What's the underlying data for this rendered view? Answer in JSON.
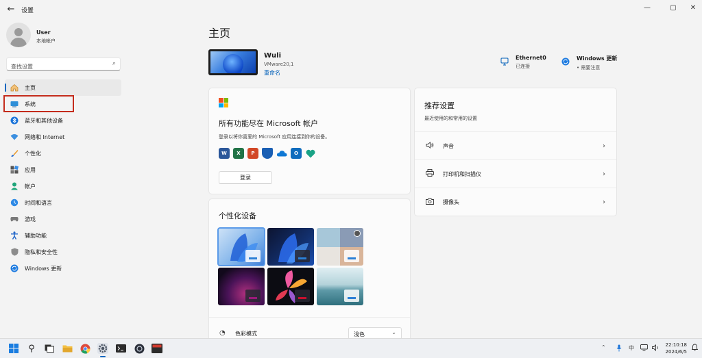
{
  "window": {
    "title": "设置",
    "back_icon": "back-arrow-icon"
  },
  "user": {
    "name": "User",
    "account_type": "本地帐户"
  },
  "search": {
    "placeholder": "查找设置"
  },
  "nav": [
    {
      "label": "主页",
      "icon": "home-icon",
      "active": true
    },
    {
      "label": "系统",
      "icon": "system-display-icon"
    },
    {
      "label": "蓝牙和其他设备",
      "icon": "bluetooth-icon"
    },
    {
      "label": "网络和 Internet",
      "icon": "wifi-icon"
    },
    {
      "label": "个性化",
      "icon": "paintbrush-icon"
    },
    {
      "label": "应用",
      "icon": "apps-icon"
    },
    {
      "label": "帐户",
      "icon": "account-icon"
    },
    {
      "label": "时间和语言",
      "icon": "globe-clock-icon"
    },
    {
      "label": "游戏",
      "icon": "gamepad-icon"
    },
    {
      "label": "辅助功能",
      "icon": "accessibility-icon"
    },
    {
      "label": "隐私和安全性",
      "icon": "shield-icon"
    },
    {
      "label": "Windows 更新",
      "icon": "update-icon"
    }
  ],
  "main": {
    "title": "主页",
    "pc": {
      "name": "Wuli",
      "model": "VMware20,1",
      "rename": "重命名"
    },
    "status": [
      {
        "title": "Ethernet0",
        "sub": "已连接",
        "icon": "ethernet-icon"
      },
      {
        "title": "Windows 更新",
        "sub": "• 需要注意",
        "icon": "update-icon"
      }
    ],
    "account_card": {
      "title": "所有功能尽在 Microsoft 帐户",
      "desc": "登录以将你喜爱的 Microsoft 应用连接到你的设备。",
      "apps": [
        "word-icon",
        "excel-icon",
        "powerpoint-icon",
        "defender-icon",
        "onedrive-icon",
        "outlook-icon",
        "family-icon"
      ],
      "signin": "登录"
    },
    "personalize_card": {
      "title": "个性化设备",
      "themes": [
        "bloom-light-theme",
        "bloom-dark-theme",
        "photo-theme",
        "glow-theme",
        "flower-theme",
        "lake-theme"
      ],
      "color_mode_label": "色彩模式",
      "color_mode_value": "浅色"
    },
    "recommended": {
      "title": "推荐设置",
      "desc": "最近使用的和常用的设置",
      "items": [
        {
          "label": "声音",
          "icon": "speaker-icon"
        },
        {
          "label": "打印机和扫描仪",
          "icon": "printer-icon"
        },
        {
          "label": "摄像头",
          "icon": "camera-icon"
        }
      ]
    }
  },
  "taskbar": {
    "input_lang": "中",
    "time": "22:10:18",
    "date": "2024/6/5"
  },
  "colors": {
    "accent": "#0067c0",
    "highlight_border": "#c42b1c"
  }
}
